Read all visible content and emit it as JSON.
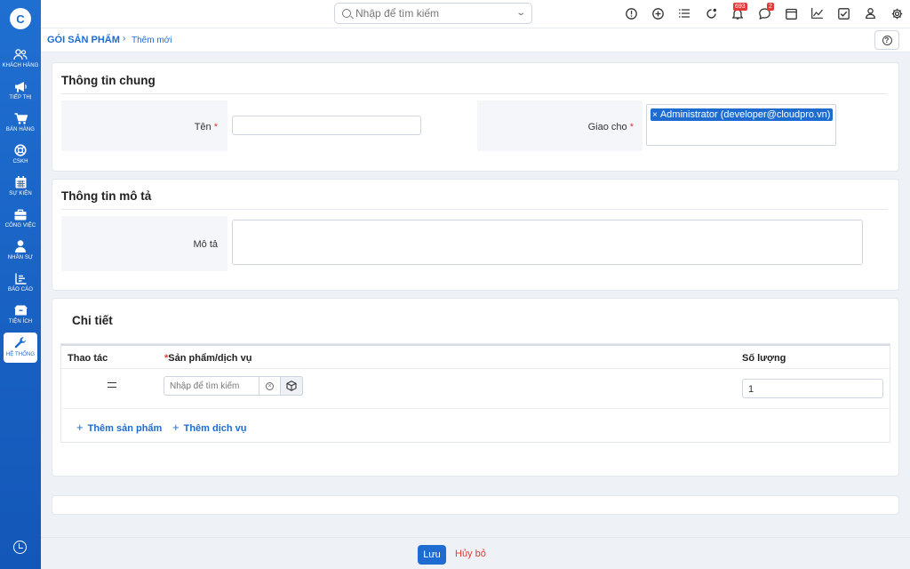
{
  "sidebar": {
    "items": [
      {
        "label": "KHÁCH HÀNG",
        "icon": "customers-icon"
      },
      {
        "label": "TIẾP THỊ",
        "icon": "megaphone-icon"
      },
      {
        "label": "BÁN HÀNG",
        "icon": "cart-icon"
      },
      {
        "label": "CSKH",
        "icon": "support-icon"
      },
      {
        "label": "SỰ KIỆN",
        "icon": "calendar-icon"
      },
      {
        "label": "CÔNG VIỆC",
        "icon": "briefcase-icon"
      },
      {
        "label": "NHÂN SỰ",
        "icon": "person-icon"
      },
      {
        "label": "BÁO CÁO",
        "icon": "report-icon"
      },
      {
        "label": "TIỆN ÍCH",
        "icon": "box-icon"
      },
      {
        "label": "HỆ THỐNG",
        "icon": "wrench-icon",
        "active": true
      }
    ]
  },
  "topbar": {
    "search_placeholder": "Nhập để tìm kiếm",
    "notifications_count": "693",
    "messages_count": "2"
  },
  "breadcrumb": {
    "module": "GÓI SẢN PHẨM",
    "page": "Thêm mới"
  },
  "general": {
    "title": "Thông tin chung",
    "name_label": "Tên",
    "assign_label": "Giao cho",
    "assignee": "Administrator (developer@cloudpro.vn)"
  },
  "description": {
    "title": "Thông tin mô tả",
    "desc_label": "Mô tả"
  },
  "detail": {
    "title": "Chi tiết",
    "col_action": "Thao tác",
    "col_product": "Sản phẩm/dịch vụ",
    "col_qty": "Số lượng",
    "product_placeholder": "Nhập để tìm kiếm",
    "qty_value": "1",
    "add_product": "Thêm sản phẩm",
    "add_service": "Thêm dịch vụ"
  },
  "footer": {
    "save": "Lưu",
    "cancel": "Hủy bỏ"
  },
  "colors": {
    "primary": "#1e6cd0",
    "danger": "#e53935"
  }
}
